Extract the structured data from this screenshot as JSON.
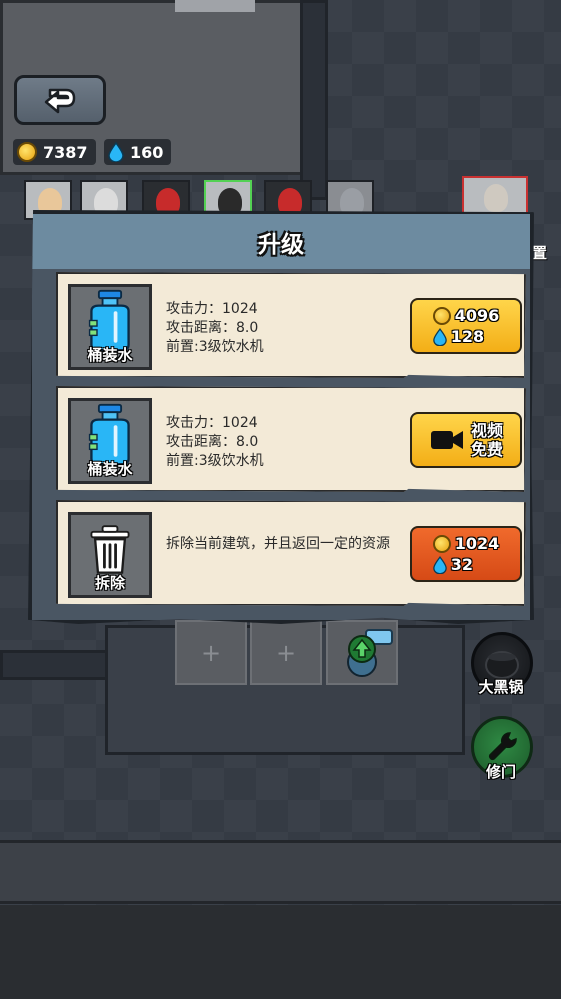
{
  "hud": {
    "gold": "7387",
    "water": "160"
  },
  "side_label_partial": "置",
  "dialog": {
    "title": "升级",
    "rows": [
      {
        "name": "桶装水",
        "stats": [
          "攻击力：1024",
          "攻击距离：8.0",
          "前置:3级饮水机"
        ],
        "cost_gold": "4096",
        "cost_water": "128",
        "button_type": "cost"
      },
      {
        "name": "桶装水",
        "stats": [
          "攻击力：1024",
          "攻击距离：8.0",
          "前置:3级饮水机"
        ],
        "video_label_1": "视频",
        "video_label_2": "免费",
        "button_type": "video"
      },
      {
        "name": "拆除",
        "desc": "拆除当前建筑，并且返回一定的资源",
        "cost_gold": "1024",
        "cost_water": "32",
        "button_type": "refund"
      }
    ]
  },
  "right_buttons": [
    {
      "label": "大黑锅",
      "icon": "cauldron-icon"
    },
    {
      "label": "修门",
      "icon": "wrench-icon"
    }
  ],
  "board": {
    "slot_plus": "+"
  },
  "colors": {
    "gold_button": "#f3ae17",
    "refund_button": "#d64a16",
    "header": "#6d8ba0",
    "card": "#f3ead7"
  }
}
